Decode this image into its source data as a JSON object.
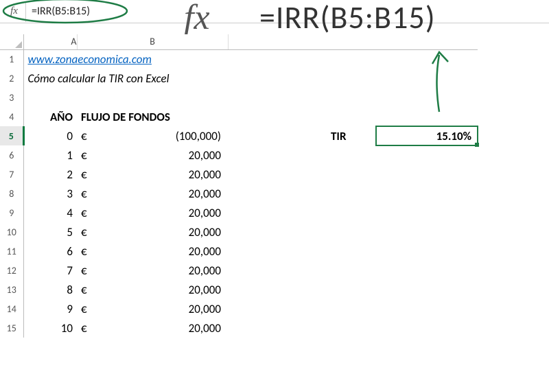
{
  "formula_bar": {
    "fx_label": "fx",
    "formula": "=IRR(B5:B15)"
  },
  "callout": {
    "big_fx": "fx",
    "big_formula": "=IRR(B5:B15)"
  },
  "headers": {
    "colA": "A",
    "colB": "B"
  },
  "rows": {
    "r1_link": "www.zonaeconomica.com",
    "r2_text": "Cómo calcular la TIR con Excel",
    "r4_a": "AÑO",
    "r4_b": "FLUJO DE FONDOS",
    "tir_label": "TIR",
    "tir_value": "15.10%"
  },
  "data_rows": [
    {
      "n": "5",
      "year": "0",
      "cur": "€",
      "amount": "(100,000)"
    },
    {
      "n": "6",
      "year": "1",
      "cur": "€",
      "amount": "20,000"
    },
    {
      "n": "7",
      "year": "2",
      "cur": "€",
      "amount": "20,000"
    },
    {
      "n": "8",
      "year": "3",
      "cur": "€",
      "amount": "20,000"
    },
    {
      "n": "9",
      "year": "4",
      "cur": "€",
      "amount": "20,000"
    },
    {
      "n": "10",
      "year": "5",
      "cur": "€",
      "amount": "20,000"
    },
    {
      "n": "11",
      "year": "6",
      "cur": "€",
      "amount": "20,000"
    },
    {
      "n": "12",
      "year": "7",
      "cur": "€",
      "amount": "20,000"
    },
    {
      "n": "13",
      "year": "8",
      "cur": "€",
      "amount": "20,000"
    },
    {
      "n": "14",
      "year": "9",
      "cur": "€",
      "amount": "20,000"
    },
    {
      "n": "15",
      "year": "10",
      "cur": "€",
      "amount": "20,000"
    }
  ],
  "row_labels": {
    "r1": "1",
    "r2": "2",
    "r3": "3",
    "r4": "4"
  }
}
